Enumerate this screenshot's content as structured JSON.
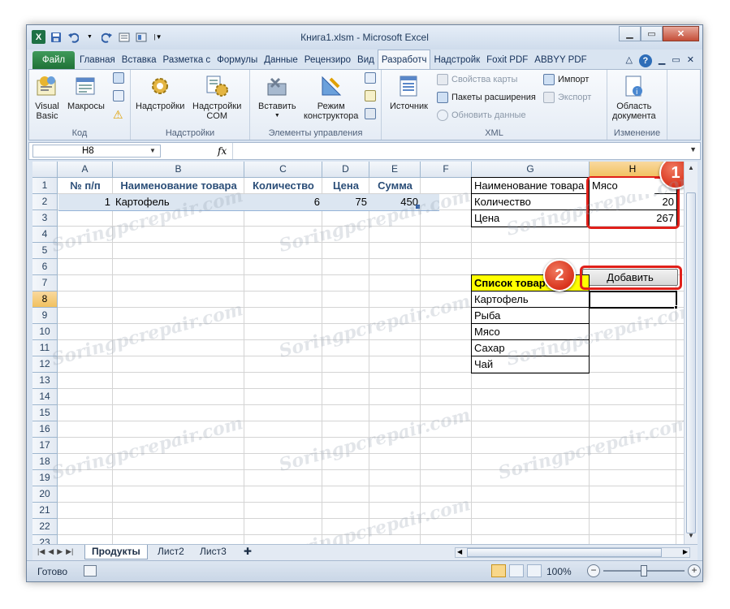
{
  "window": {
    "title": "Книга1.xlsm - Microsoft Excel",
    "qat_icons": [
      "excel-logo-icon",
      "save-icon",
      "undo-icon",
      "redo-icon",
      "quick-access-icon-1",
      "quick-access-icon-2",
      "customize-qat-icon"
    ]
  },
  "tabs": [
    {
      "label": "Файл"
    },
    {
      "label": "Главная"
    },
    {
      "label": "Вставка"
    },
    {
      "label": "Разметка с"
    },
    {
      "label": "Формулы"
    },
    {
      "label": "Данные"
    },
    {
      "label": "Рецензиро"
    },
    {
      "label": "Вид"
    },
    {
      "label": "Разработч"
    },
    {
      "label": "Надстройк"
    },
    {
      "label": "Foxit PDF"
    },
    {
      "label": "ABBYY PDF"
    }
  ],
  "ribbon": {
    "groups": {
      "code": "Код",
      "addins": "Надстройки",
      "controls": "Элементы управления",
      "xml": "XML",
      "modify": "Изменение"
    },
    "buttons": {
      "visual_basic_1": "Visual",
      "visual_basic_2": "Basic",
      "macros": "Макросы",
      "addins": "Надстройки",
      "com_addins_1": "Надстройки",
      "com_addins_2": "COM",
      "insert": "Вставить",
      "design_mode_1": "Режим",
      "design_mode_2": "конструктора",
      "source": "Источник",
      "map_properties": "Свойства карты",
      "expansion_packs": "Пакеты расширения",
      "refresh_data": "Обновить данные",
      "import": "Импорт",
      "export": "Экспорт",
      "doc_panel_1": "Область",
      "doc_panel_2": "документа"
    }
  },
  "formula_bar": {
    "name_box": "H8",
    "fx": "fx",
    "formula": ""
  },
  "columns": [
    "A",
    "B",
    "C",
    "D",
    "E",
    "F",
    "G",
    "H"
  ],
  "rows": [
    "1",
    "2",
    "3",
    "4",
    "5",
    "6",
    "7",
    "8",
    "9",
    "10",
    "11",
    "12",
    "13",
    "14",
    "15",
    "16",
    "17",
    "18",
    "19",
    "20",
    "21",
    "22",
    "23"
  ],
  "table": {
    "headers": [
      "№ п/п",
      "Наименование товара",
      "Количество",
      "Цена",
      "Сумма"
    ],
    "row": [
      "1",
      "Картофель",
      "6",
      "75",
      "450"
    ]
  },
  "input_form": {
    "name_label": "Наименование товара",
    "name_value": "Мясо",
    "qty_label": "Количество",
    "qty_value": "20",
    "price_label": "Цена",
    "price_value": "267",
    "add_button": "Добавить"
  },
  "product_list": {
    "title": "Список товаров",
    "items": [
      "Картофель",
      "Рыба",
      "Мясо",
      "Сахар",
      "Чай"
    ]
  },
  "callouts": {
    "one": "1",
    "two": "2"
  },
  "sheets": [
    {
      "label": "Продукты",
      "active": true
    },
    {
      "label": "Лист2",
      "active": false
    },
    {
      "label": "Лист3",
      "active": false
    }
  ],
  "status": {
    "ready": "Готово",
    "zoom": "100%"
  },
  "watermark": "Soringpcrepair.com",
  "colors": {
    "selected_header": "#f1c15f",
    "list_title_fill": "#ffff00",
    "callout": "#e0201a",
    "file_tab": "#1f7137"
  }
}
